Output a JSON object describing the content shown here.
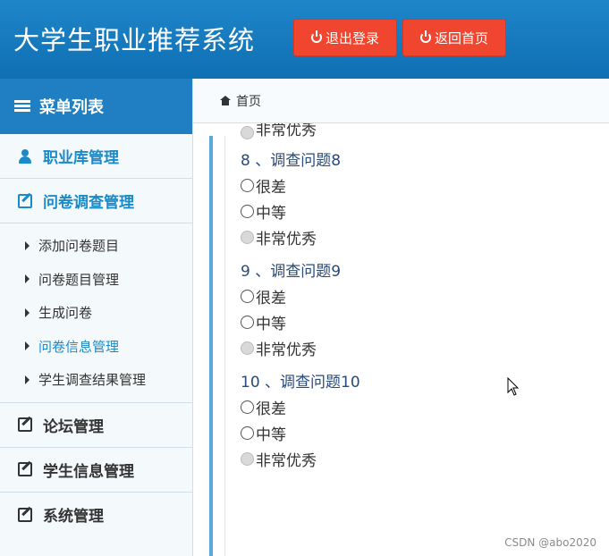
{
  "header": {
    "title": "大学生职业推荐系统",
    "logout_label": "退出登录",
    "home_label": "返回首页"
  },
  "sidebar": {
    "menu_title": "菜单列表",
    "items": [
      {
        "label": "职业库管理",
        "icon": "user-icon"
      },
      {
        "label": "问卷调查管理",
        "icon": "edit-icon"
      },
      {
        "label": "论坛管理",
        "icon": "edit-icon"
      },
      {
        "label": "学生信息管理",
        "icon": "edit-icon"
      },
      {
        "label": "系统管理",
        "icon": "edit-icon"
      }
    ],
    "sub_items": [
      {
        "label": "添加问卷题目"
      },
      {
        "label": "问卷题目管理"
      },
      {
        "label": "生成问卷"
      },
      {
        "label": "问卷信息管理"
      },
      {
        "label": "学生调查结果管理"
      }
    ]
  },
  "breadcrumb": {
    "home": "首页"
  },
  "survey": {
    "partial_option": "非常优秀",
    "questions": [
      {
        "title": "8 、调查问题8",
        "options": [
          "很差",
          "中等",
          "非常优秀"
        ]
      },
      {
        "title": "9 、调查问题9",
        "options": [
          "很差",
          "中等",
          "非常优秀"
        ]
      },
      {
        "title": "10 、调查问题10",
        "options": [
          "很差",
          "中等",
          "非常优秀"
        ]
      }
    ]
  },
  "watermark": "CSDN @abo2020"
}
